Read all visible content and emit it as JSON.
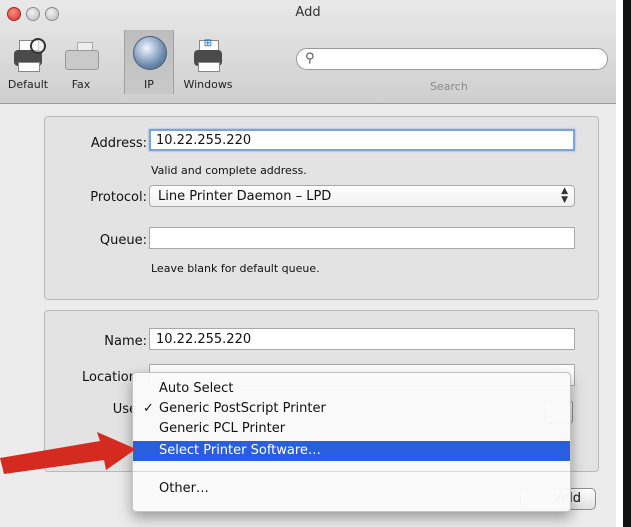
{
  "window": {
    "title": "Add"
  },
  "toolbar": {
    "items": [
      {
        "label": "Default",
        "icon": "default-printer-icon"
      },
      {
        "label": "Fax",
        "icon": "fax-icon"
      },
      {
        "label": "IP",
        "icon": "globe-icon",
        "selected": true
      },
      {
        "label": "Windows",
        "icon": "windows-printer-icon"
      }
    ],
    "search": {
      "placeholder": "",
      "label": "Search"
    }
  },
  "connection": {
    "address_label": "Address:",
    "address_value": "10.22.255.220",
    "address_hint": "Valid and complete address.",
    "protocol_label": "Protocol:",
    "protocol_value": "Line Printer Daemon – LPD",
    "queue_label": "Queue:",
    "queue_value": "",
    "queue_hint": "Leave blank for default queue."
  },
  "details": {
    "name_label": "Name:",
    "name_value": "10.22.255.220",
    "location_label": "Location",
    "use_label": "Use"
  },
  "menu": {
    "items": [
      {
        "label": "Auto Select"
      },
      {
        "label": "Generic PostScript Printer",
        "checked": true,
        "check_mark": "✓"
      },
      {
        "label": "Generic PCL Printer"
      },
      {
        "label": "Select Printer Software…",
        "highlighted": true
      },
      {
        "label": "Other…"
      }
    ]
  },
  "add_button": {
    "label": "Add"
  },
  "colors": {
    "highlight": "#2a5ee0",
    "arrow": "#d42a1f",
    "focus_ring": "#7aa4d9"
  }
}
